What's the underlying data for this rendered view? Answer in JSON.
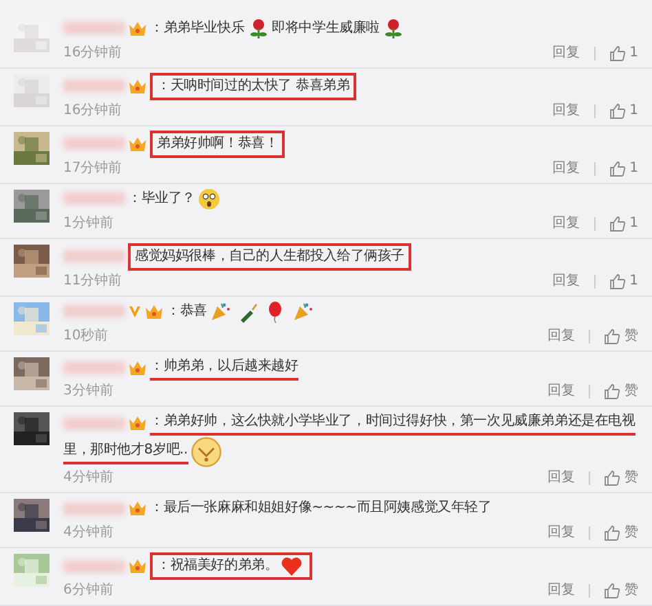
{
  "comments": [
    {
      "badges": [
        {
          "kind": "vip"
        }
      ],
      "segments": [
        {
          "kind": "text",
          "text": "：弟弟毕业快乐"
        },
        {
          "kind": "rose"
        },
        {
          "kind": "text",
          "text": "即将中学生威廉啦"
        },
        {
          "kind": "rose"
        }
      ],
      "boxed": false,
      "underlined": false,
      "time": "16分钟前",
      "reply": "回复",
      "like": "1"
    },
    {
      "badges": [
        {
          "kind": "vip"
        }
      ],
      "segments": [
        {
          "kind": "text",
          "text": "：天呐时间过的太快了 恭喜弟弟"
        }
      ],
      "boxed": true,
      "underlined": false,
      "time": "16分钟前",
      "reply": "回复",
      "like": "1"
    },
    {
      "badges": [
        {
          "kind": "vip"
        }
      ],
      "segments": [
        {
          "kind": "text",
          "text": "弟弟好帅啊！恭喜！"
        }
      ],
      "boxed": true,
      "underlined": false,
      "time": "17分钟前",
      "reply": "回复",
      "like": "1"
    },
    {
      "segments": [
        {
          "kind": "text",
          "text": "：毕业了？"
        },
        {
          "kind": "surprised"
        }
      ],
      "boxed": false,
      "underlined": false,
      "time": "1分钟前",
      "reply": "回复",
      "like": "1"
    },
    {
      "segments": [
        {
          "kind": "text",
          "text": "感觉妈妈很棒，自己的人生都投入给了俩孩子"
        }
      ],
      "boxed": true,
      "underlined": false,
      "time": "11分钟前",
      "reply": "回复",
      "like": "1"
    },
    {
      "badges": [
        {
          "kind": "verified"
        },
        {
          "kind": "vip"
        }
      ],
      "segments": [
        {
          "kind": "text",
          "text": "：恭喜"
        },
        {
          "kind": "party"
        },
        {
          "kind": "bottle"
        },
        {
          "kind": "balloon"
        },
        {
          "kind": "party"
        }
      ],
      "boxed": false,
      "underlined": false,
      "time": "10秒前",
      "reply": "回复",
      "like": "赞"
    },
    {
      "badges": [
        {
          "kind": "vip"
        }
      ],
      "segments": [
        {
          "kind": "text",
          "text": "：帅弟弟，以后越来越好"
        }
      ],
      "boxed": false,
      "underlined": true,
      "time": "3分钟前",
      "reply": "回复",
      "like": "赞"
    },
    {
      "badges": [
        {
          "kind": "vip"
        }
      ],
      "segments": [
        {
          "kind": "text",
          "text": "：弟弟好帅，这么快就小学毕业了，时间过得好快，第一次见威廉弟弟还是在电视"
        },
        {
          "kind": "text",
          "text": "里，那时他才8岁吧.."
        },
        {
          "kind": "shrug"
        }
      ],
      "boxed": false,
      "underlined": true,
      "time": "4分钟前",
      "reply": "回复",
      "like": "赞"
    },
    {
      "badges": [
        {
          "kind": "vip"
        }
      ],
      "segments": [
        {
          "kind": "text",
          "text": "：最后一张麻麻和姐姐好像~~~~而且阿姨感觉又年轻了"
        }
      ],
      "boxed": false,
      "underlined": false,
      "time": "4分钟前",
      "reply": "回复",
      "like": "赞"
    },
    {
      "badges": [
        {
          "kind": "vip"
        }
      ],
      "segments": [
        {
          "kind": "text",
          "text": "：祝福美好的弟弟。"
        },
        {
          "kind": "heart"
        }
      ],
      "boxed": true,
      "underlined": false,
      "time": "6分钟前",
      "reply": "回复",
      "like": "赞"
    }
  ]
}
